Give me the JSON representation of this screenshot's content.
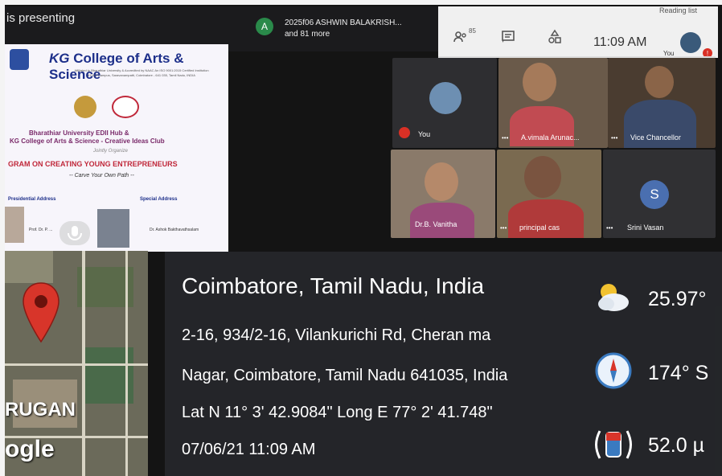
{
  "meet": {
    "presenting_text": "is presenting",
    "presenter": {
      "avatar_letter": "A",
      "name": "2025f06 ASHWIN BALAKRISH...",
      "others": "and 81 more"
    },
    "browser": {
      "reading_list": "Reading list"
    },
    "toolbar": {
      "people_icon": "people-icon",
      "people_count": "85",
      "time": "11:09 AM",
      "you_label": "You"
    }
  },
  "slide": {
    "college": "College of Arts & Science",
    "college_prefix": "KG",
    "affiliation": "Affiliated to Bharathiar University & Accredited by NAAC An ISO 9001:2015 Certified Institution KGISL Campus, Saravanampatti, Coimbatore - 641 035, Tamil Nadu, INDIA",
    "org_line1": "Bharathiar University EDII Hub &",
    "org_line2": "KG College of Arts & Science - Creative Ideas Club",
    "jointly": "Jointly Organize",
    "program": "GRAM ON CREATING YOUNG ENTREPRENEURS",
    "tagline": "-- Carve Your Own Path --",
    "presidential": "Presidential Address",
    "special": "Special Address",
    "speaker1": "Prof. Dr. P. ...",
    "speaker2": "Dr. Ashok Bakthavathsalam"
  },
  "participants": [
    {
      "label": "You"
    },
    {
      "label": "A.vimala Arunac..."
    },
    {
      "label": "Vice Chancellor"
    },
    {
      "label": "Dr.B. Vanitha"
    },
    {
      "label": "principal cas"
    },
    {
      "label": "Srini Vasan",
      "avatar_letter": "S"
    }
  ],
  "map": {
    "place": "RUGAN",
    "brand": "ogle"
  },
  "location": {
    "city": "Coimbatore, Tamil Nadu, India",
    "address1": "2-16, 934/2-16, Vilankurichi Rd, Cheran ma",
    "address2": "Nagar, Coimbatore, Tamil Nadu 641035, India",
    "coords": "Lat N 11° 3' 42.9084\" Long E 77° 2' 41.748\"",
    "datetime": "07/06/21 11:09 AM",
    "temperature": "25.97°",
    "wind": "174° S",
    "magnetic": "52.0 µ"
  },
  "colors": {
    "map_pin": "#d8352a",
    "college_blue": "#1d2f8a",
    "program_red": "#c0283a"
  }
}
